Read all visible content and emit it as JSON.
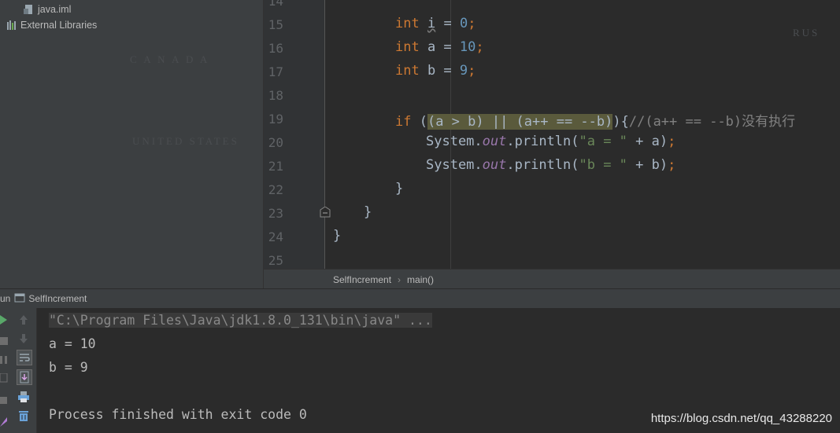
{
  "project_tree": {
    "items": [
      {
        "label": "java.iml",
        "icon": "file-icon"
      },
      {
        "label": "External Libraries",
        "icon": "library-icon"
      }
    ]
  },
  "editor": {
    "lines": [
      {
        "num": "14",
        "text": ""
      },
      {
        "num": "15",
        "text": "int i = 0;"
      },
      {
        "num": "16",
        "text": "int a = 10;"
      },
      {
        "num": "17",
        "text": "int b = 9;"
      },
      {
        "num": "18",
        "text": ""
      },
      {
        "num": "19",
        "text": "if ((a > b) || (a++ == --b)){//(a++ == --b)没有执行"
      },
      {
        "num": "20",
        "text": "System.out.println(\"a = \" + a);"
      },
      {
        "num": "21",
        "text": "System.out.println(\"b = \" + b);"
      },
      {
        "num": "22",
        "text": "}"
      },
      {
        "num": "23",
        "text": "}"
      },
      {
        "num": "24",
        "text": "}"
      },
      {
        "num": "25",
        "text": ""
      }
    ]
  },
  "breadcrumb": {
    "class_name": "SelfIncrement",
    "method_name": "main()"
  },
  "run": {
    "tab_prefix": "un",
    "tab_label": "SelfIncrement",
    "console_lines": [
      "\"C:\\Program Files\\Java\\jdk1.8.0_131\\bin\\java\" ...",
      "a = 10",
      "b = 9",
      "",
      "Process finished with exit code 0"
    ]
  },
  "watermark": "https://blog.csdn.net/qq_43288220",
  "colors": {
    "keyword": "#cc7832",
    "number": "#6897bb",
    "string": "#6a8759",
    "comment": "#808080",
    "field": "#9876aa",
    "highlight": "#5a5a3c"
  }
}
